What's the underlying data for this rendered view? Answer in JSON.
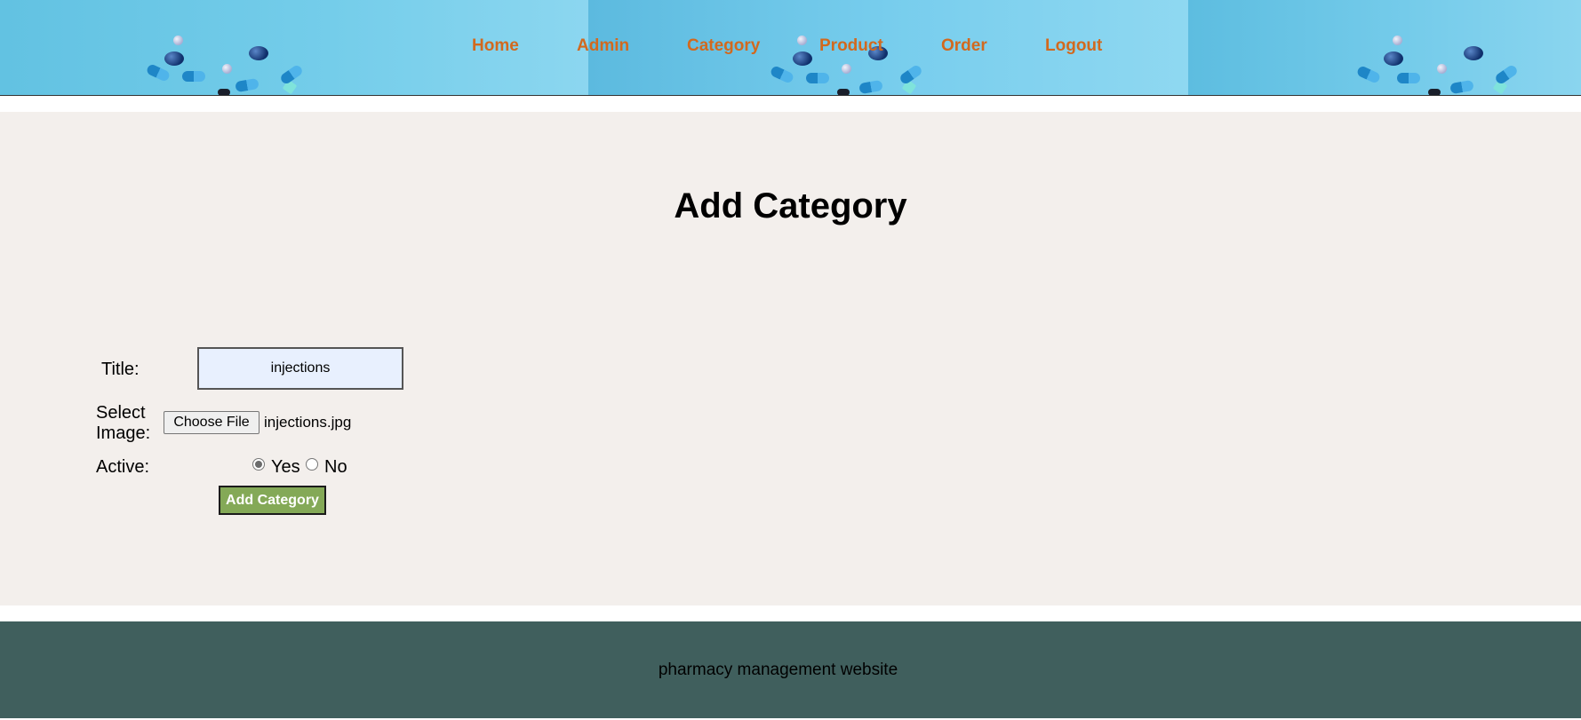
{
  "nav": {
    "items": [
      {
        "label": "Home"
      },
      {
        "label": "Admin"
      },
      {
        "label": "Category"
      },
      {
        "label": "Product"
      },
      {
        "label": "Order"
      },
      {
        "label": "Logout"
      }
    ],
    "link_color": "#d2691e"
  },
  "page": {
    "title": "Add Category"
  },
  "form": {
    "title_label": "Title:",
    "title_value": "injections",
    "image_label_line1": "Select",
    "image_label_line2": "Image:",
    "choose_file_label": "Choose File",
    "file_name": "injections.jpg",
    "active_label": "Active:",
    "active_options": [
      {
        "label": "Yes",
        "checked": true
      },
      {
        "label": "No",
        "checked": false
      }
    ],
    "submit_label": "Add Category",
    "submit_color": "#84a957"
  },
  "footer": {
    "text": "pharmacy management website",
    "background": "#405f5d"
  }
}
